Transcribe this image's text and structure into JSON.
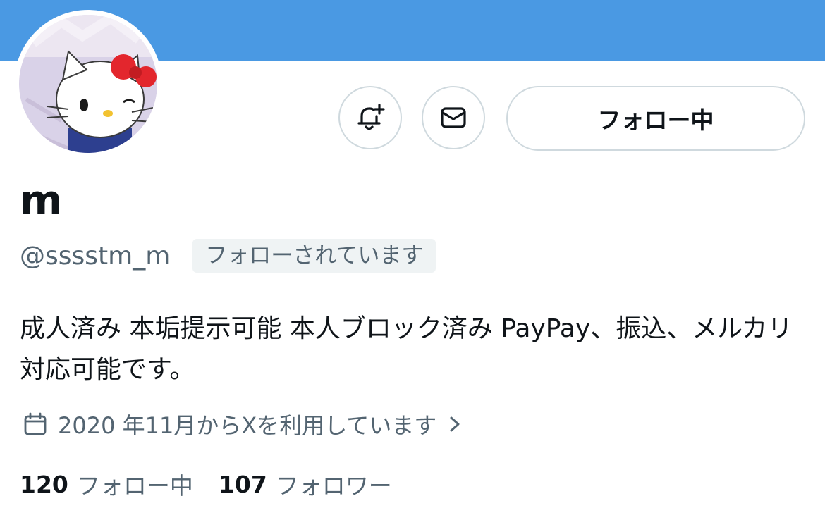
{
  "profile": {
    "display_name": "m",
    "handle": "@sssstm_m",
    "follows_you_badge": "フォローされています",
    "bio": "成人済み 本垢提示可能 本人ブロック済み PayPay、振込、メルカリ対応可能です。",
    "joined": "2020 年11月からXを利用しています",
    "avatar_icon": "avatar-hello-kitty"
  },
  "actions": {
    "notify_icon": "bell-plus-icon",
    "message_icon": "envelope-icon",
    "follow_label": "フォロー中"
  },
  "stats": {
    "following_count": "120",
    "following_label": "フォロー中",
    "followers_count": "107",
    "followers_label": "フォロワー"
  },
  "colors": {
    "banner": "#4a99e3",
    "secondary_text": "#536471",
    "border": "#cfd9de"
  }
}
